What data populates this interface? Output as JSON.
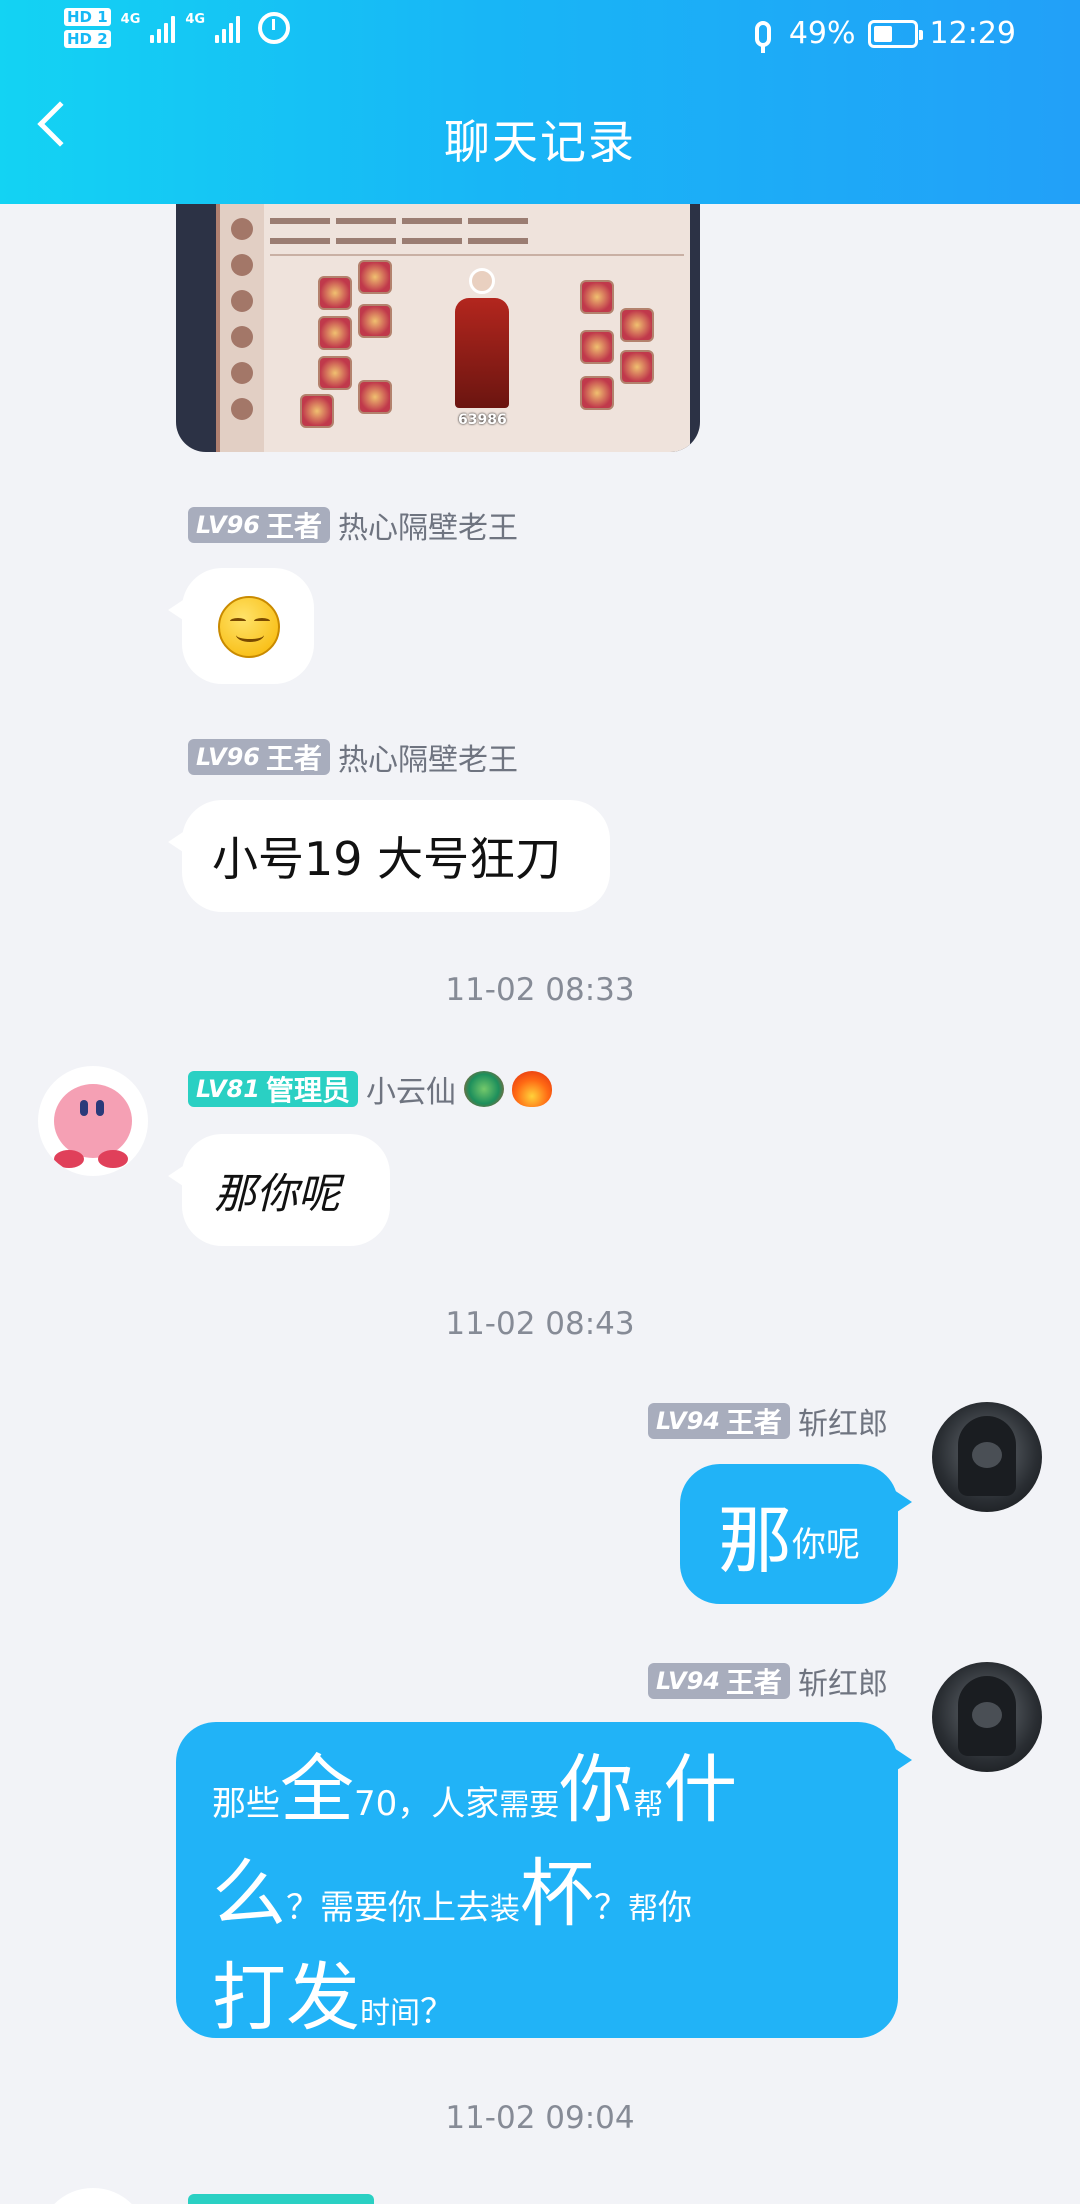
{
  "status_bar": {
    "sim1": "HD 1",
    "sim2": "HD 2",
    "network1": "4G",
    "network2": "4G",
    "battery_percent": "49%",
    "battery_level": 0.49,
    "time": "12:29"
  },
  "header": {
    "title": "聊天记录"
  },
  "shared_image": {
    "score": "63986",
    "alt": "game equipment screenshot"
  },
  "messages": [
    {
      "level": "LV96",
      "role": "王者",
      "name": "热心隔壁老王",
      "content_type": "emoji"
    },
    {
      "level": "LV96",
      "role": "王者",
      "name": "热心隔壁老王",
      "text": "小号19 大号狂刀"
    },
    {
      "time": "11-02 08:33"
    },
    {
      "level": "LV81",
      "role": "管理员",
      "name": "小云仙",
      "text": "那你呢"
    },
    {
      "time": "11-02 08:43"
    },
    {
      "level": "LV94",
      "role": "王者",
      "name": "斩红郎",
      "text_parts": [
        "那",
        "你呢"
      ]
    },
    {
      "level": "LV94",
      "role": "王者",
      "name": "斩红郎",
      "text_parts": [
        "那些",
        "全",
        "70，人家",
        "需要",
        "你",
        "帮",
        "什",
        "么",
        "？需要你上去",
        "装",
        "杯",
        "？",
        "帮",
        "你",
        "打发",
        "时间",
        "？"
      ]
    },
    {
      "time": "11-02 09:04"
    }
  ],
  "colors": {
    "header_start": "#13d3f3",
    "header_end": "#22a0f8",
    "bubble_self": "#21b3f7",
    "badge_king": "#a8adbd",
    "badge_admin": "#2ad0c3",
    "background": "#f2f3f7"
  }
}
